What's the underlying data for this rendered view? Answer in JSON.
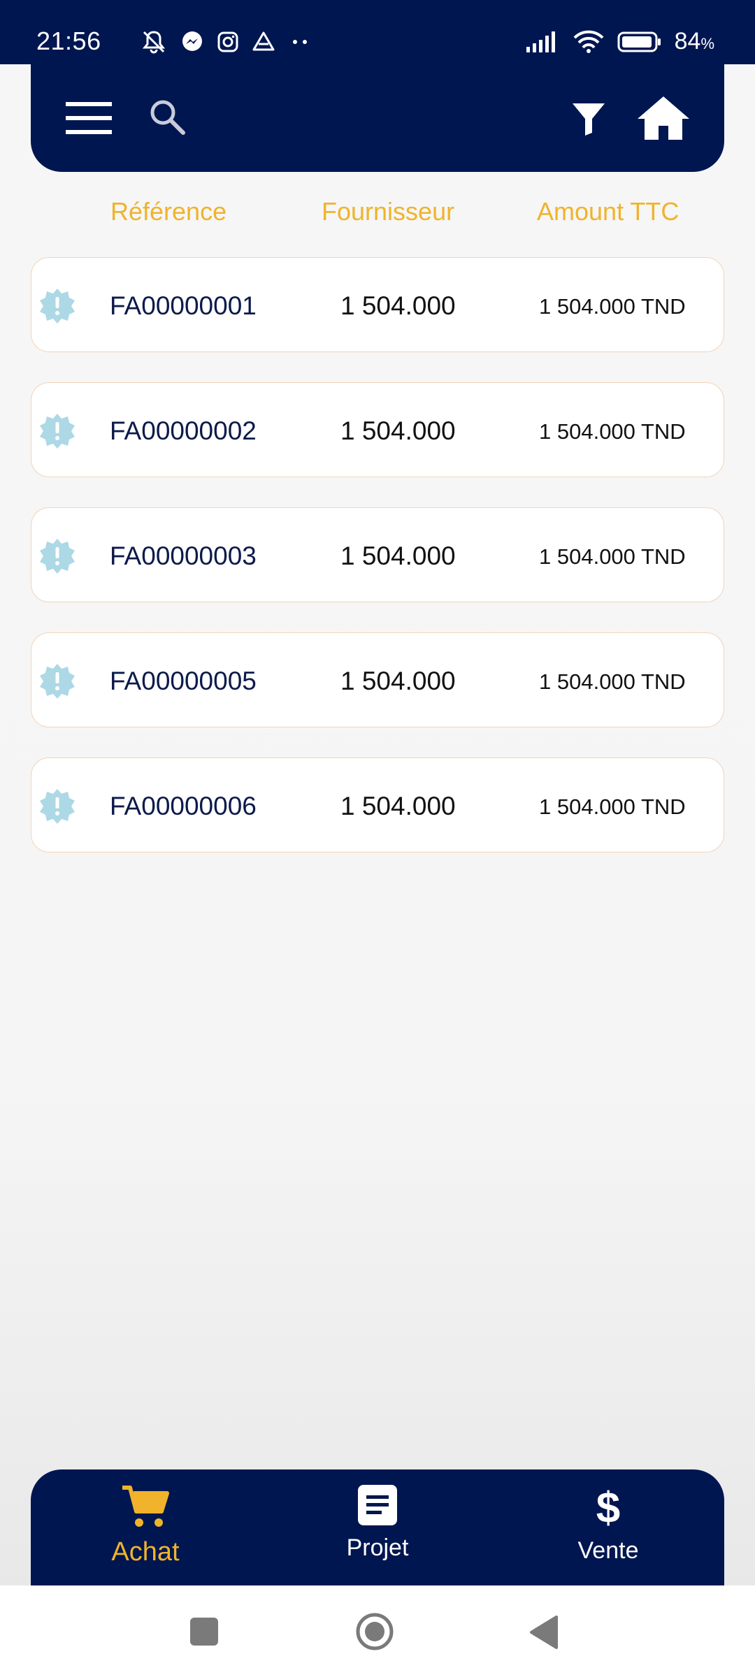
{
  "status_bar": {
    "time": "21:56",
    "battery": "84",
    "battery_unit": "%",
    "left_icons": [
      "silent-icon",
      "messenger-icon",
      "instagram-icon",
      "drive-icon",
      "more-dots-icon"
    ],
    "right_icons": [
      "signal-icon",
      "wifi-icon",
      "battery-icon"
    ]
  },
  "header": {
    "menu_icon": "menu-icon",
    "search_icon": "search-icon",
    "filter_icon": "filter-icon",
    "home_icon": "home-icon"
  },
  "columns": {
    "reference": "Référence",
    "supplier": "Fournisseur",
    "amount": "Amount TTC"
  },
  "rows": [
    {
      "reference": "FA00000001",
      "supplier": "1 504.000",
      "amount": "1 504.000 TND"
    },
    {
      "reference": "FA00000002",
      "supplier": "1 504.000",
      "amount": "1 504.000 TND"
    },
    {
      "reference": "FA00000003",
      "supplier": "1 504.000",
      "amount": "1 504.000 TND"
    },
    {
      "reference": "FA00000005",
      "supplier": "1 504.000",
      "amount": "1 504.000 TND"
    },
    {
      "reference": "FA00000006",
      "supplier": "1 504.000",
      "amount": "1 504.000 TND"
    }
  ],
  "bottom_nav": {
    "items": [
      {
        "label": "Achat",
        "icon": "cart-icon",
        "active": true
      },
      {
        "label": "Projet",
        "icon": "document-icon",
        "active": false
      },
      {
        "label": "Vente",
        "icon": "dollar-icon",
        "active": false
      }
    ]
  },
  "colors": {
    "primary": "#001650",
    "accent": "#f0b32b",
    "badge": "#add8e6",
    "row_border": "#f2d4b8"
  }
}
